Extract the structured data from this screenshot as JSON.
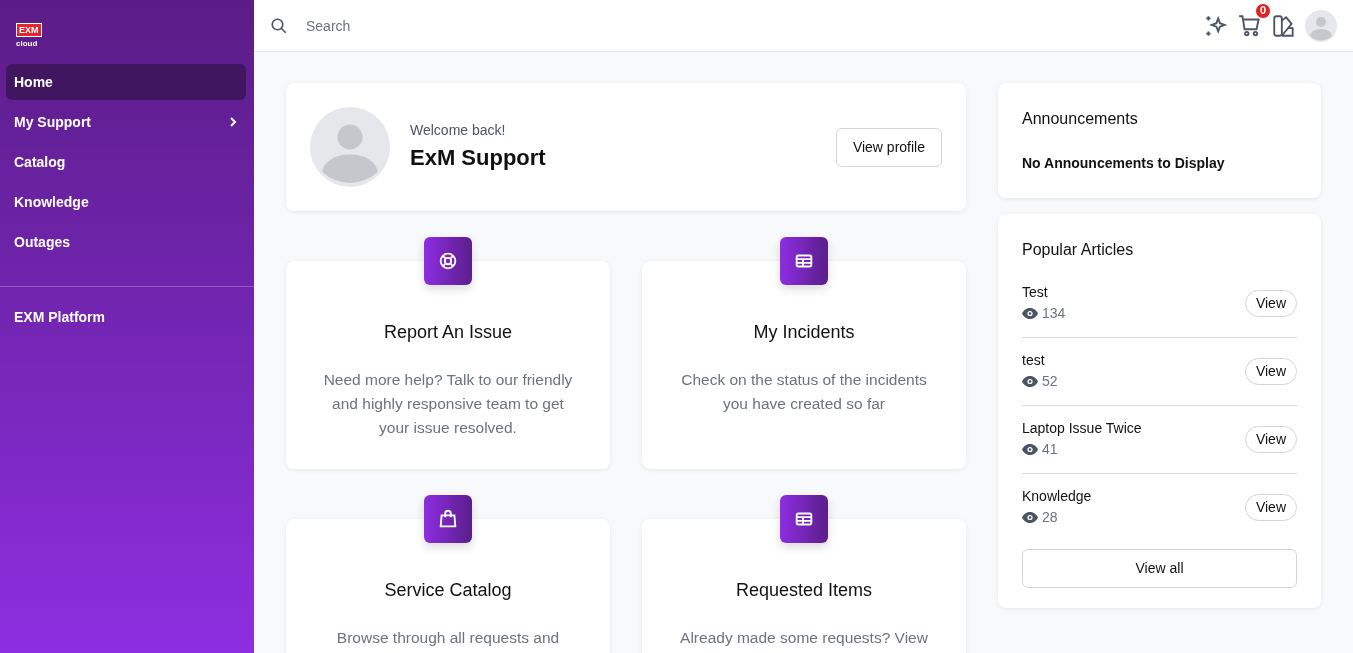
{
  "logo": {
    "mark": "EXM",
    "sub": "cloud"
  },
  "sidebar": {
    "items": [
      {
        "label": "Home",
        "selected": true,
        "kind": "link"
      },
      {
        "label": "My Support",
        "selected": false,
        "kind": "group"
      },
      {
        "label": "Catalog",
        "selected": false,
        "kind": "link"
      },
      {
        "label": "Knowledge",
        "selected": false,
        "kind": "link"
      },
      {
        "label": "Outages",
        "selected": false,
        "kind": "link"
      }
    ],
    "footer_items": [
      {
        "label": "EXM Platform",
        "selected": false
      }
    ]
  },
  "topbar": {
    "search": {
      "placeholder": "Search"
    },
    "cart_count": "0"
  },
  "profile": {
    "greeting": "Welcome back!",
    "name": "ExM Support",
    "button": "View profile"
  },
  "tiles": [
    {
      "title": "Report An Issue",
      "text": "Need more help? Talk to our friendly and highly responsive team to get your issue resolved."
    },
    {
      "title": "My Incidents",
      "text": "Check on the status of the incidents you have created so far"
    },
    {
      "title": "Service Catalog",
      "text": "Browse through all requests and"
    },
    {
      "title": "Requested Items",
      "text": "Already made some requests? View"
    }
  ],
  "announcements": {
    "title": "Announcements",
    "message": "No Announcements to Display"
  },
  "popular_articles": {
    "title": "Popular Articles",
    "items": [
      {
        "title": "Test",
        "views": "134",
        "button": "View"
      },
      {
        "title": "test",
        "views": "52",
        "button": "View"
      },
      {
        "title": "Laptop Issue Twice",
        "views": "41",
        "button": "View"
      },
      {
        "title": "Knowledge",
        "views": "28",
        "button": "View"
      }
    ],
    "view_all": "View all"
  }
}
